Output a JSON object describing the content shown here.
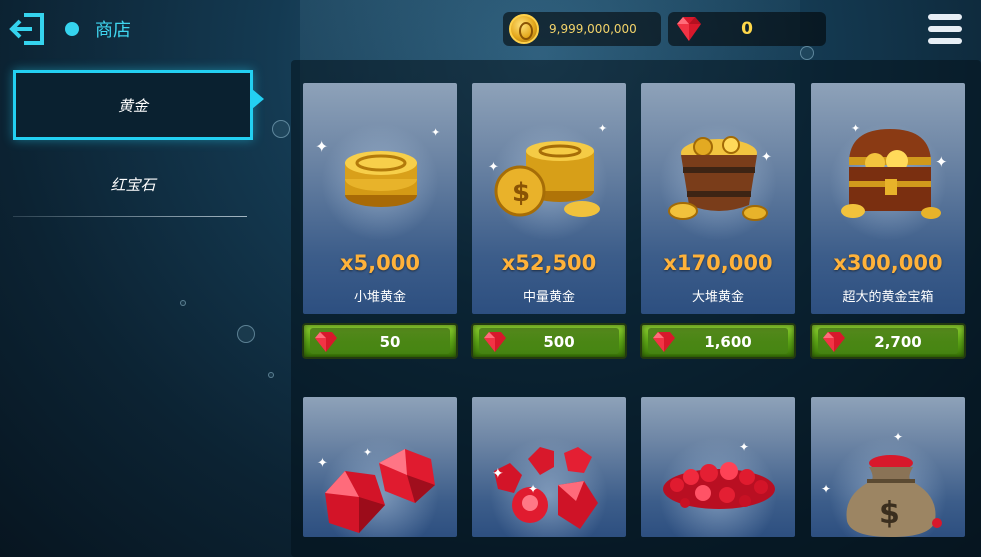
{
  "header": {
    "title": "商店",
    "coins": "9,999,000,000",
    "gems": "0"
  },
  "sidebar": {
    "items": [
      {
        "label": "黄金",
        "active": true
      },
      {
        "label": "红宝石",
        "active": false
      }
    ]
  },
  "shop": {
    "gold_packs": [
      {
        "amount": "x5,000",
        "name": "小堆黄金",
        "price": "50",
        "icon": "gold-coin-stack-icon"
      },
      {
        "amount": "x52,500",
        "name": "中量黄金",
        "price": "500",
        "icon": "gold-coin-pile-icon"
      },
      {
        "amount": "x170,000",
        "name": "大堆黄金",
        "price": "1,600",
        "icon": "gold-coin-bucket-icon"
      },
      {
        "amount": "x300,000",
        "name": "超大的黄金宝箱",
        "price": "2,700",
        "icon": "treasure-chest-icon"
      }
    ],
    "ruby_packs": [
      {
        "icon": "ruby-pair-icon"
      },
      {
        "icon": "ruby-cluster-icon"
      },
      {
        "icon": "ruby-pile-icon"
      },
      {
        "icon": "ruby-sack-icon"
      }
    ]
  },
  "colors": {
    "accent": "#23d0f2",
    "amount": "#ffb23a",
    "button": "#5da616"
  }
}
